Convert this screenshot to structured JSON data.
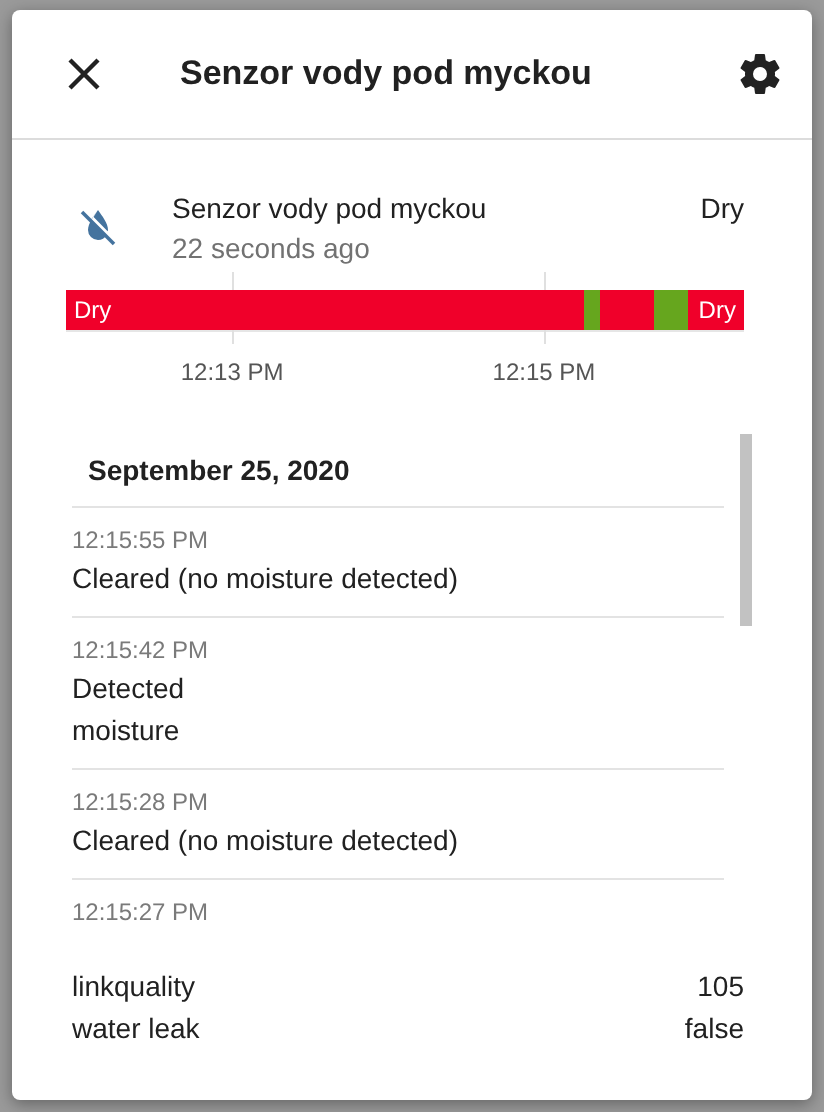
{
  "dialog": {
    "title": "Senzor vody pod myckou"
  },
  "entity": {
    "name": "Senzor vody pod myckou",
    "last_changed": "22 seconds ago",
    "state": "Dry"
  },
  "timeline": {
    "segments": [
      {
        "kind": "dry",
        "label": "Dry"
      },
      {
        "kind": "wet"
      },
      {
        "kind": "dry"
      },
      {
        "kind": "wet"
      },
      {
        "kind": "dry",
        "label": "Dry"
      }
    ],
    "ticks": [
      {
        "label": "12:13 PM"
      },
      {
        "label": "12:15 PM"
      }
    ]
  },
  "logbook": {
    "date": "September 25, 2020",
    "entries": [
      {
        "time": "12:15:55 PM",
        "message": "Cleared (no moisture detected)"
      },
      {
        "time": "12:15:42 PM",
        "message": "Detected\nmoisture"
      },
      {
        "time": "12:15:28 PM",
        "message": "Cleared (no moisture detected)"
      },
      {
        "time": "12:15:27 PM"
      }
    ]
  },
  "attributes": [
    {
      "name": "linkquality",
      "value": "105"
    },
    {
      "name": "water leak",
      "value": "false"
    }
  ]
}
